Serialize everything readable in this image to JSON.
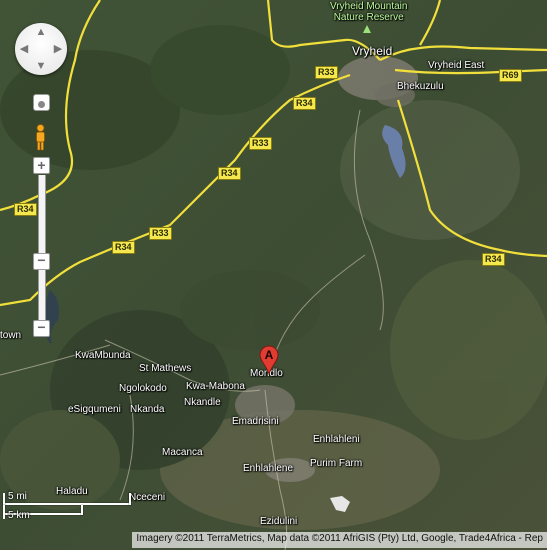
{
  "map": {
    "imagery": "satellite",
    "places": {
      "nature_reserve": "Vryheid Mountain\nNature Reserve",
      "vryheid": "Vryheid",
      "vryheid_east": "Vryheid East",
      "bhekuzulu": "Bhekuzulu",
      "kwambunda": "KwaMbunda",
      "st_mathews": "St Mathews",
      "ngolokodo": "Ngolokodo",
      "kwa_mabona": "Kwa-Mabona",
      "mondlo": "Mondlo",
      "esigqumeni": "eSigqumeni",
      "nkanda": "Nkanda",
      "nkandle": "Nkandle",
      "emadrisini": "Emadrisini",
      "enhlahleni": "Enhlahleni",
      "macanca": "Macanca",
      "enhlahlene": "Enhlahlene",
      "purim_farm": "Purim Farm",
      "haladu": "Haladu",
      "nceceni": "Nceceni",
      "ezidulini": "Ezidulini",
      "town_left_edge": "town"
    },
    "road_shields": {
      "r33_a": "R33",
      "r34_a": "R34",
      "r33_b": "R33",
      "r34_b": "R34",
      "r34_c": "R34",
      "r33_c": "R33",
      "r34_d": "R34",
      "r69": "R69",
      "r34_e": "R34"
    },
    "marker": {
      "letter": "A",
      "color": "#e03c31"
    }
  },
  "controls": {
    "pan_up": "▲",
    "pan_down": "▼",
    "pan_left": "◀",
    "pan_right": "▶",
    "zoom_in": "+",
    "zoom_out": "−",
    "zoom_out_bottom": "−",
    "zoom_level_fraction": 0.6
  },
  "scale": {
    "miles": "5 mi",
    "km": "5 km"
  },
  "copyright": "Imagery ©2011 TerraMetrics, Map data ©2011 AfriGIS (Pty) Ltd, Google, Trade4Africa - Rep"
}
